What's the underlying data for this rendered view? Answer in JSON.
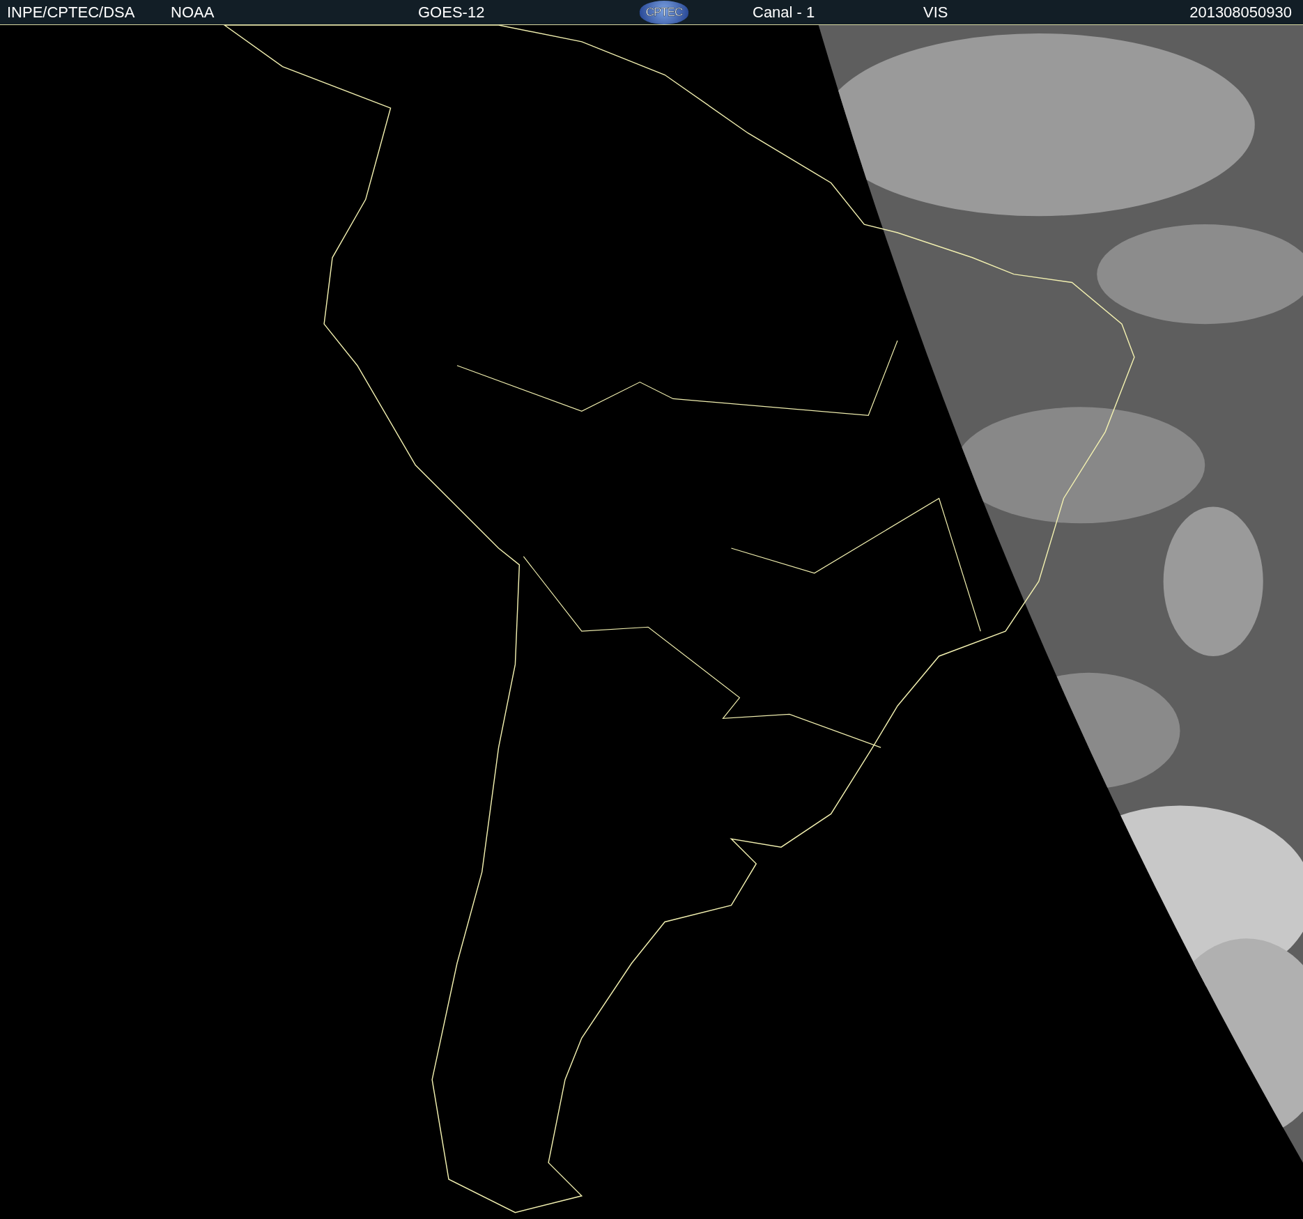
{
  "header": {
    "labels": [
      {
        "text": "INPE/CPTEC/DSA"
      },
      {
        "text": "NOAA"
      },
      {
        "text": "GOES-12"
      },
      {
        "kind": "logo",
        "text": "CPTEC"
      },
      {
        "text": "Canal - 1"
      },
      {
        "text": "VIS"
      },
      {
        "text": "201308050930"
      }
    ]
  }
}
